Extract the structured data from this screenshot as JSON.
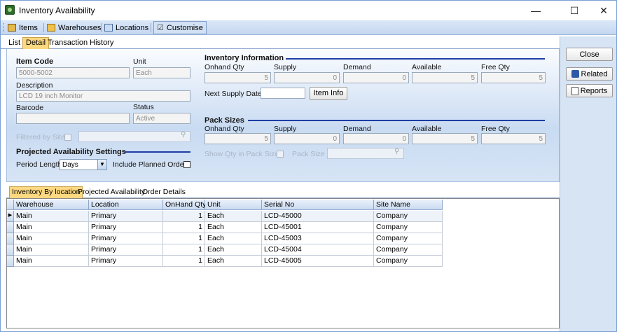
{
  "window": {
    "title": "Inventory Availability",
    "minimize": "—",
    "maximize": "☐",
    "close": "✕"
  },
  "toolbar": {
    "items": "Items",
    "warehouses": "Warehouses",
    "locations": "Locations",
    "customise": "Customise"
  },
  "tabs": {
    "list": "List",
    "detail": "Detail",
    "history": "Transaction History"
  },
  "right": {
    "close": "Close",
    "related": "Related",
    "reports": "Reports"
  },
  "detail": {
    "item_code_label": "Item Code",
    "item_code": "5000-5002",
    "unit_label": "Unit",
    "unit": "Each",
    "description_label": "Description",
    "description": "LCD 19 inch Monitor",
    "barcode_label": "Barcode",
    "barcode": "",
    "status_label": "Status",
    "status": "Active",
    "filtered_by_site": "Filtered by Site",
    "proj_header": "Projected Availability Settings",
    "period_label": "Period Length",
    "period": "Days",
    "include_planned": "Include Planned Orders"
  },
  "inventory": {
    "header": "Inventory Information",
    "onhand_label": "Onhand Qty",
    "supply_label": "Supply",
    "demand_label": "Demand",
    "available_label": "Available",
    "free_label": "Free Qty",
    "onhand": "5",
    "supply": "0",
    "demand": "0",
    "available": "5",
    "free": "5",
    "next_supply_label": "Next Supply Date",
    "next_supply": "",
    "item_info": "Item Info"
  },
  "pack": {
    "header": "Pack Sizes",
    "onhand_label": "Onhand Qty",
    "supply_label": "Supply",
    "demand_label": "Demand",
    "available_label": "Available",
    "free_label": "Free Qty",
    "onhand": "5",
    "supply": "0",
    "demand": "0",
    "available": "5",
    "free": "5",
    "show_qty": "Show Qty in Pack Size",
    "pack_size_label": "Pack Size"
  },
  "subtabs": {
    "by_location": "Inventory By location",
    "projected": "Projected Availability",
    "orders": "Order Details"
  },
  "grid": {
    "columns": [
      "Warehouse",
      "Location",
      "OnHand Qty",
      "Unit",
      "Serial No",
      "Site Name"
    ],
    "rows": [
      [
        "Main",
        "Primary",
        "1",
        "Each",
        "LCD-45000",
        "Company"
      ],
      [
        "Main",
        "Primary",
        "1",
        "Each",
        "LCD-45001",
        "Company"
      ],
      [
        "Main",
        "Primary",
        "1",
        "Each",
        "LCD-45003",
        "Company"
      ],
      [
        "Main",
        "Primary",
        "1",
        "Each",
        "LCD-45004",
        "Company"
      ],
      [
        "Main",
        "Primary",
        "1",
        "Each",
        "LCD-45005",
        "Company"
      ]
    ]
  }
}
